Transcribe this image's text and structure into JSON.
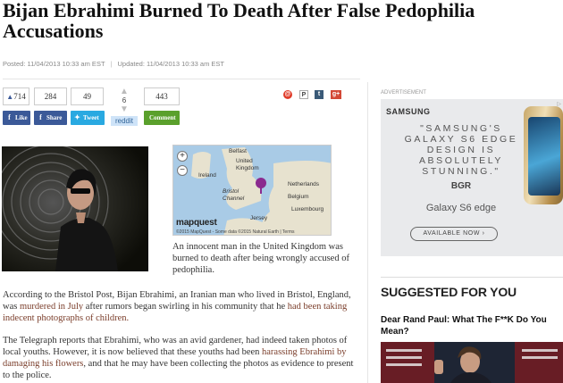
{
  "article": {
    "title": "Bijan Ebrahimi Burned To Death After False Pedophilia Accusations",
    "posted": "Posted: 11/04/2013 10:33 am EST",
    "updated": "Updated: 11/04/2013 10:33 am EST"
  },
  "share": {
    "fb_count": "714",
    "fb_label": "Like",
    "share_count": "284",
    "share_label": "Share",
    "tweet_count": "49",
    "tweet_label": "Tweet",
    "reddit_count": "6",
    "reddit_label": "reddit",
    "comment_count": "443",
    "comment_label": "Comment"
  },
  "map": {
    "labels": [
      "Belfast",
      "United Kingdom",
      "Ireland",
      "Bristol Channel",
      "Netherlands",
      "Belgium",
      "Luxembourg",
      "Jersey"
    ],
    "brand": "mapquest",
    "copyright": "©2015 MapQuest - Some data ©2015 Natural Earth | Terms"
  },
  "caption": "An innocent man in the United Kingdom was burned to death after being wrongly accused of pedophilia.",
  "paragraphs": {
    "p1_a": "According to the Bristol Post, Bijan Ebrahimi, an Iranian man who lived in Bristol, England, was ",
    "p1_link": "murdered in July",
    "p1_b": " after rumors began swirling in his community that he ",
    "p1_link2": "had been taking indecent photographs of children.",
    "p2_a": "The Telegraph reports that Ebrahimi, who was an avid gardener, had indeed taken photos of local youths. However, it is now believed that these youths had been ",
    "p2_link": "harassing Ebrahimi by damaging his flowers",
    "p2_b": ", and that he may have been collecting the photos as evidence to present to the police."
  },
  "sidebar": {
    "advertisement_label": "ADVERTISEMENT",
    "ad": {
      "brand": "SAMSUNG",
      "tagline": "\"SAMSUNG'S GALAXY S6 EDGE DESIGN IS ABSOLUTELY STUNNING.\"",
      "source": "BGR",
      "product": "Galaxy S6 edge",
      "cta": "AVAILABLE NOW ›"
    },
    "suggested_heading": "SUGGESTED FOR YOU",
    "suggested_title": "Dear Rand Paul: What The F**K Do You Mean?"
  },
  "colors": {
    "facebook": "#3b5998",
    "twitter": "#29a9e1",
    "comment": "#5aa02c",
    "link": "#7a3d2a"
  }
}
